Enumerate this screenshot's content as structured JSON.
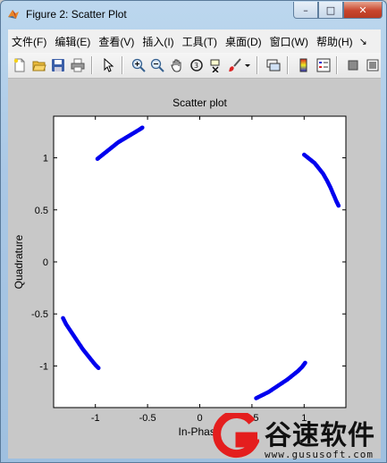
{
  "window": {
    "title": "Figure 2: Scatter Plot",
    "buttons": {
      "minimize": "–",
      "maximize": "□",
      "close": "✕"
    }
  },
  "menu": {
    "items": [
      "文件(F)",
      "编辑(E)",
      "查看(V)",
      "插入(I)",
      "工具(T)",
      "桌面(D)",
      "窗口(W)",
      "帮助(H)"
    ],
    "more": "↘"
  },
  "toolbar": {
    "icons": [
      "new-figure-icon",
      "open-file-icon",
      "save-icon",
      "print-icon",
      "pointer-icon",
      "zoom-in-icon",
      "zoom-out-icon",
      "pan-hand-icon",
      "rotate-3d-icon",
      "data-cursor-icon",
      "brush-icon",
      "dropdown-arrow-icon",
      "link-plot-icon",
      "colorbar-icon",
      "legend-icon",
      "hide-plot-tools-icon",
      "show-plot-tools-icon"
    ]
  },
  "chart_data": {
    "type": "scatter",
    "title": "Scatter plot",
    "xlabel": "In-Phase",
    "ylabel": "Quadrature",
    "xlim": [
      -1.4,
      1.4
    ],
    "ylim": [
      -1.4,
      1.4
    ],
    "xticks": [
      -1,
      -0.5,
      0,
      0.5,
      1
    ],
    "yticks": [
      1,
      0.5,
      0,
      -0.5,
      -1
    ],
    "grid": false,
    "marker_color": "#0000ee",
    "series": [
      {
        "points": [
          [
            -0.98,
            0.99
          ],
          [
            -0.93,
            1.03
          ],
          [
            -0.88,
            1.07
          ],
          [
            -0.83,
            1.11
          ],
          [
            -0.78,
            1.15
          ],
          [
            -0.73,
            1.18
          ],
          [
            -0.68,
            1.21
          ],
          [
            -0.63,
            1.24
          ],
          [
            -0.58,
            1.27
          ],
          [
            -0.55,
            1.29
          ]
        ]
      },
      {
        "points": [
          [
            1.0,
            1.03
          ],
          [
            1.05,
            0.99
          ],
          [
            1.1,
            0.95
          ],
          [
            1.14,
            0.9
          ],
          [
            1.18,
            0.85
          ],
          [
            1.22,
            0.78
          ],
          [
            1.25,
            0.72
          ],
          [
            1.28,
            0.65
          ],
          [
            1.31,
            0.58
          ],
          [
            1.33,
            0.54
          ]
        ]
      },
      {
        "points": [
          [
            -1.31,
            -0.54
          ],
          [
            -1.28,
            -0.6
          ],
          [
            -1.24,
            -0.66
          ],
          [
            -1.2,
            -0.72
          ],
          [
            -1.16,
            -0.78
          ],
          [
            -1.12,
            -0.84
          ],
          [
            -1.08,
            -0.89
          ],
          [
            -1.04,
            -0.94
          ],
          [
            -1.0,
            -0.99
          ],
          [
            -0.97,
            -1.02
          ]
        ]
      },
      {
        "points": [
          [
            0.54,
            -1.31
          ],
          [
            0.6,
            -1.28
          ],
          [
            0.66,
            -1.25
          ],
          [
            0.72,
            -1.21
          ],
          [
            0.78,
            -1.17
          ],
          [
            0.84,
            -1.13
          ],
          [
            0.89,
            -1.09
          ],
          [
            0.94,
            -1.05
          ],
          [
            0.98,
            -1.01
          ],
          [
            1.01,
            -0.97
          ]
        ]
      }
    ]
  },
  "watermark": {
    "name": "谷速软件",
    "url": "www.gususoft.com",
    "color": "#e41e1e"
  }
}
